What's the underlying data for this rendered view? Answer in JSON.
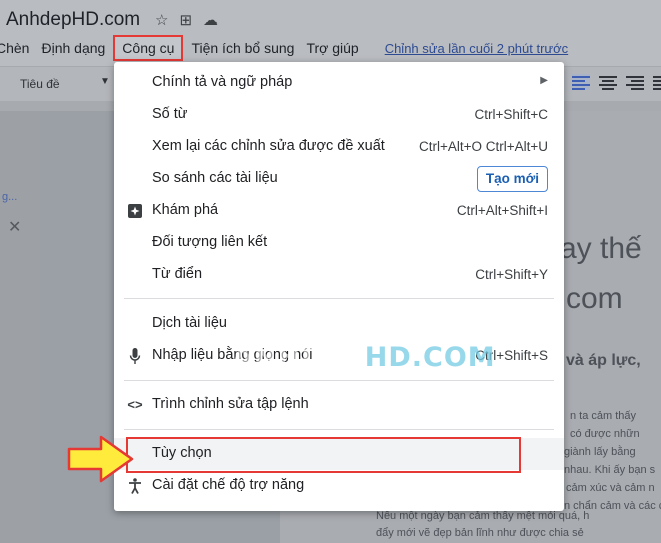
{
  "doc": {
    "title": "AnhdepHD.com"
  },
  "menubar": {
    "items": [
      "Chèn",
      "Định dạng",
      "Công cụ",
      "Tiện ích bổ sung",
      "Trợ giúp"
    ],
    "last_edit": "Chỉnh sửa lần cuối 2 phút trước"
  },
  "toolbar": {
    "style_select": "Tiêu đề"
  },
  "tools_menu": {
    "items": [
      {
        "label": "Chính tả và ngữ pháp",
        "shortcut": ""
      },
      {
        "label": "Số từ",
        "shortcut": "Ctrl+Shift+C"
      },
      {
        "label": "Xem lại các chỉnh sửa được đề xuất",
        "shortcut": "Ctrl+Alt+O Ctrl+Alt+U"
      },
      {
        "label": "So sánh các tài liệu",
        "badge": "Tạo mới"
      },
      {
        "label": "Khám phá",
        "shortcut": "Ctrl+Alt+Shift+I"
      },
      {
        "label": "Đối tượng liên kết",
        "shortcut": ""
      },
      {
        "label": "Từ điển",
        "shortcut": "Ctrl+Shift+Y"
      },
      {
        "label": "Dịch tài liệu",
        "shortcut": ""
      },
      {
        "label": "Nhập liệu bằng giọng nói",
        "shortcut": "Ctrl+Shift+S"
      },
      {
        "label": "Trình chỉnh sửa tập lệnh",
        "shortcut": ""
      },
      {
        "label": "Tùy chọn",
        "shortcut": ""
      },
      {
        "label": "Cài đặt chế độ trợ năng",
        "shortcut": ""
      }
    ]
  },
  "background": {
    "heading_1": "ay thế",
    "heading_2": "com",
    "subheading": "và áp lực,",
    "lines": [
      "n ta cảm thấy",
      "có được nhữn",
      "giành lấy bằng",
      "nhau. Khi ấy bạn s",
      "cảm xúc và cảm n",
      "n chẩn cảm và các c",
      "Nếu một ngày bạn cảm thấy mệt mỏi quá, h",
      "đẩy mới vẽ đẹp bản lĩnh như được chia sẻ"
    ]
  },
  "watermark": {
    "text_a": "ANHDEP",
    "text_b": "HD",
    "text_c": ".COM"
  },
  "icons": {
    "star": "star-icon",
    "move": "move-to-folder-icon",
    "cloud": "cloud-status-icon",
    "explore": "explore-icon",
    "mic": "microphone-icon",
    "code": "code-icon",
    "accessibility": "accessibility-icon",
    "submenu": "chevron-right-icon"
  },
  "colors": {
    "highlight": "#e53935",
    "arrow": "#ffeb3b",
    "badge": "#1a5fb4"
  }
}
